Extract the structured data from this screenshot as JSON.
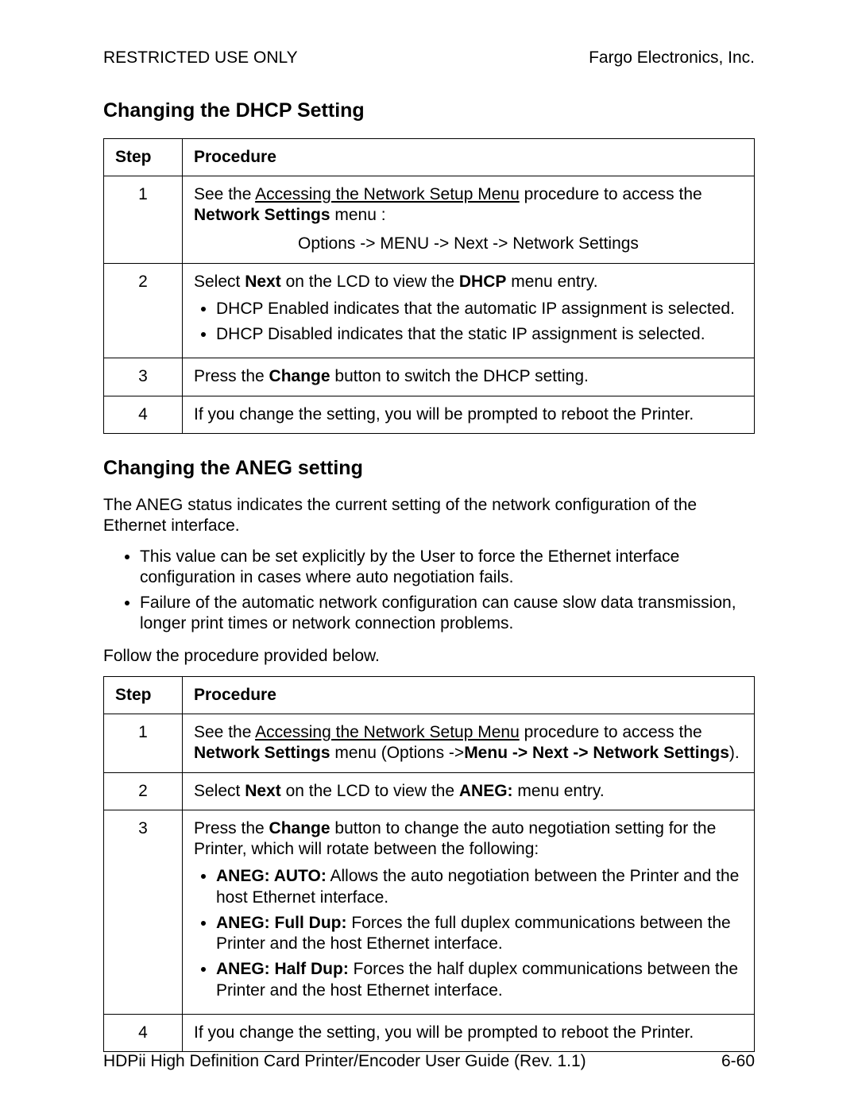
{
  "header": {
    "left": "RESTRICTED USE ONLY",
    "right": "Fargo Electronics, Inc."
  },
  "section1": {
    "heading": "Changing the DHCP Setting",
    "col_step": "Step",
    "col_proc": "Procedure",
    "r1_pre": "See the ",
    "r1_link": "Accessing the Network Setup Menu",
    "r1_post": " procedure to access the ",
    "r1_bold": "Network Settings",
    "r1_tail": " menu :",
    "r1_path": "Options ->  MENU -> Next -> Network Settings",
    "r2_a": "Select ",
    "r2_b": "Next",
    "r2_c": " on the LCD to view the ",
    "r2_d": "DHCP",
    "r2_e": " menu entry.",
    "r2_bul1": "DHCP Enabled indicates that the automatic IP assignment is selected.",
    "r2_bul2": "DHCP Disabled indicates that the static IP assignment is selected.",
    "r3_a": "Press the ",
    "r3_b": "Change",
    "r3_c": " button to switch the DHCP setting.",
    "r4": "If you change the setting, you will be prompted to reboot the Printer.",
    "s1": "1",
    "s2": "2",
    "s3": "3",
    "s4": "4"
  },
  "section2": {
    "heading": "Changing the ANEG setting",
    "intro": "The ANEG status indicates the current setting of the network configuration of the Ethernet interface.",
    "b1": "This value can be set explicitly by the User to force the Ethernet interface configuration in cases where auto negotiation fails.",
    "b2": "Failure of the automatic network configuration can cause slow data transmission, longer print times or network connection problems.",
    "follow": "Follow the procedure provided below.",
    "col_step": "Step",
    "col_proc": "Procedure",
    "r1_pre": "See the ",
    "r1_link": "Accessing the Network Setup Menu",
    "r1_post": " procedure to access the ",
    "r1_bold1": "Network Settings",
    "r1_mid": " menu (Options ->",
    "r1_bold2": "Menu -> Next -> Network Settings",
    "r1_tail": ").",
    "r2_a": "Select ",
    "r2_b": "Next",
    "r2_c": " on the LCD to view the ",
    "r2_d": "ANEG:",
    "r2_e": " menu entry.",
    "r3_a": "Press the ",
    "r3_b": "Change",
    "r3_c": " button to change the auto negotiation setting for the Printer, which will rotate between the following:",
    "r3_li1_b": "ANEG: AUTO:",
    "r3_li1_t": "  Allows the auto negotiation between the Printer and the host Ethernet interface.",
    "r3_li2_b": "ANEG: Full Dup:",
    "r3_li2_t": "  Forces the full duplex communications between the Printer and the host Ethernet interface.",
    "r3_li3_b": "ANEG: Half Dup:",
    "r3_li3_t": "  Forces the half duplex communications between the Printer and the host Ethernet interface.",
    "r4": "If you change the setting, you will be prompted to reboot the Printer.",
    "s1": "1",
    "s2": "2",
    "s3": "3",
    "s4": "4"
  },
  "footer": {
    "left": "HDPii High Definition Card Printer/Encoder User Guide (Rev. 1.1)",
    "right": "6-60"
  }
}
